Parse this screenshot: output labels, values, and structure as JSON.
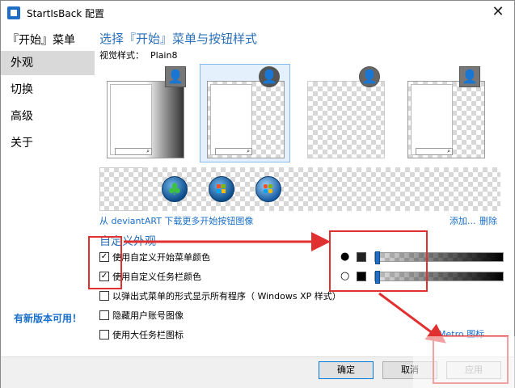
{
  "window": {
    "title": "StartIsBack 配置",
    "close_glyph": "✕"
  },
  "sidebar": {
    "title": "『开始』菜单",
    "items": [
      {
        "label": "外观",
        "selected": true
      },
      {
        "label": "切换",
        "selected": false
      },
      {
        "label": "高级",
        "selected": false
      },
      {
        "label": "关于",
        "selected": false
      }
    ],
    "update_notice": "有新版本可用！"
  },
  "main": {
    "title": "选择『开始』菜单与按钮样式",
    "visual_style_label": "视觉样式：",
    "visual_style_value": "Plain8",
    "styles": [
      {
        "selected": false,
        "avatar_icon": "user-icon"
      },
      {
        "selected": true,
        "avatar_icon": "user-icon"
      },
      {
        "selected": false,
        "avatar_icon": "user-icon"
      },
      {
        "selected": false,
        "avatar_icon": "user-icon"
      }
    ],
    "orbs": [
      {
        "kind": "blank"
      },
      {
        "kind": "clover-orb",
        "glyph": "♣"
      },
      {
        "kind": "windows-orb"
      },
      {
        "kind": "windows7-orb"
      }
    ],
    "deviant_link": "从 deviantART 下载更多开始按钮图像",
    "add_link": "添加...",
    "delete_link": "删除"
  },
  "customize": {
    "header": "自定义外观",
    "options": [
      {
        "label": "使用自定义开始菜单颜色",
        "checked": true
      },
      {
        "label": "使用自定义任务栏颜色",
        "checked": true
      },
      {
        "label": "以弹出式菜单的形式显示所有程序（ Windows XP 样式）",
        "checked": false
      },
      {
        "label": "隐藏用户账号图像",
        "checked": false
      },
      {
        "label": "使用大任务栏图标",
        "checked": false
      }
    ],
    "color_rows": [
      {
        "icon": "💧",
        "icon_name": "filled-drop-icon",
        "color": "#222222",
        "opacity": 0.02
      },
      {
        "icon": "💧",
        "icon_name": "outline-drop-icon",
        "color": "#000000",
        "opacity": 0.02
      }
    ],
    "metro_link": "Metro 图标"
  },
  "footer": {
    "ok": "确定",
    "cancel": "取消",
    "apply": "应用"
  },
  "colors": {
    "accent": "#2a6fb8",
    "annotation": "#e03030",
    "link": "#1a6fc9"
  }
}
